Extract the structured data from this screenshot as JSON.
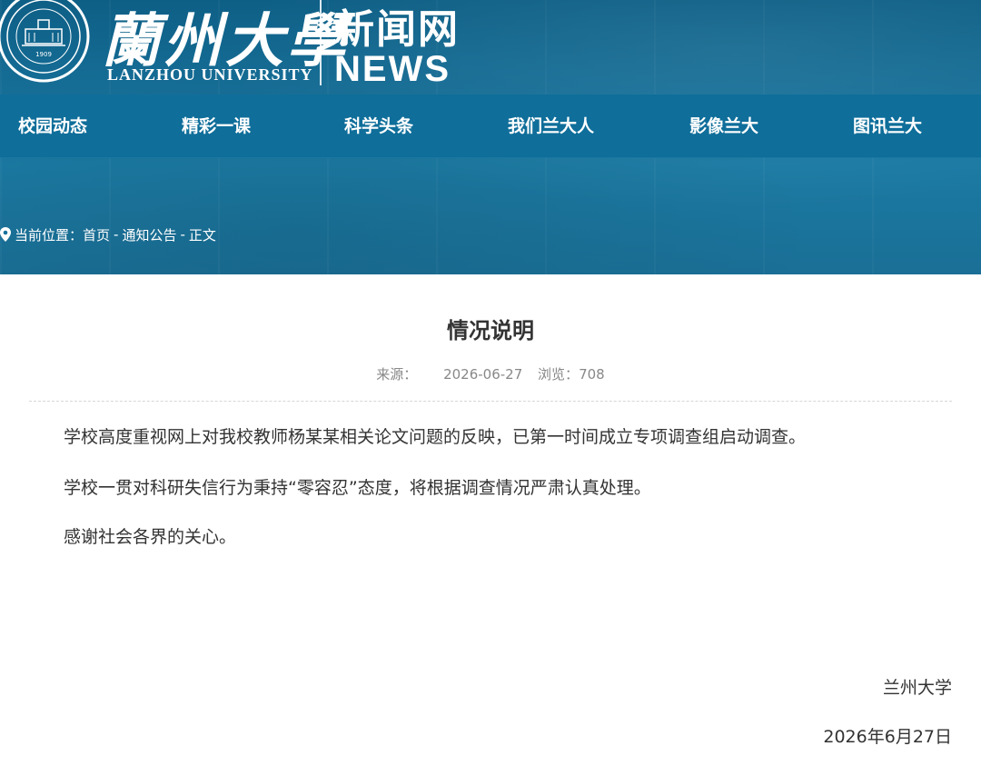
{
  "header": {
    "logo_cn": "蘭州大學",
    "logo_en": "LANZHOU UNIVERSITY",
    "seal_year": "1909",
    "news_cn": "新闻网",
    "news_en": "NEWS"
  },
  "nav": {
    "items": [
      {
        "label": "校园动态"
      },
      {
        "label": "精彩一课"
      },
      {
        "label": "科学头条"
      },
      {
        "label": "我们兰大人"
      },
      {
        "label": "影像兰大"
      },
      {
        "label": "图讯兰大"
      }
    ]
  },
  "breadcrumb": {
    "prefix": "当前位置：",
    "items": [
      "首页",
      "通知公告",
      "正文"
    ],
    "separator": "-"
  },
  "article": {
    "title": "情况说明",
    "source_label": "来源：",
    "date": "2026-06-27",
    "views_label": "浏览：",
    "views": "708",
    "paragraphs": [
      "学校高度重视网上对我校教师杨某某相关论文问题的反映，已第一时间成立专项调查组启动调查。",
      "学校一贯对科研失信行为秉持“零容忍”态度，将根据调查情况严肃认真处理。",
      "感谢社会各界的关心。"
    ],
    "signature": "兰州大学",
    "sign_date": "2026年6月27日"
  },
  "colors": {
    "header_bg": "#17719a",
    "nav_bg": "#0f6e9a",
    "text": "#333333",
    "meta": "#888888"
  },
  "icons": {
    "breadcrumb": "location-pin-icon",
    "seal": "university-seal-icon"
  }
}
